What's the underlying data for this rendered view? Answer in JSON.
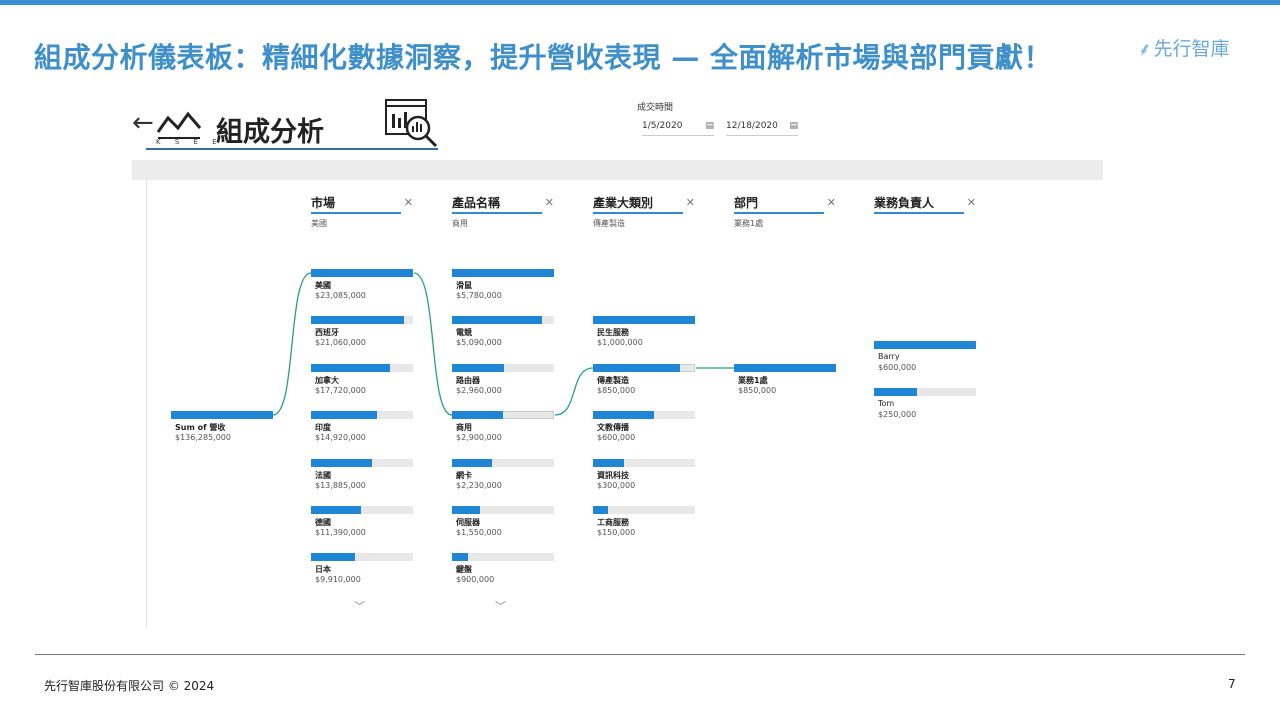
{
  "slide": {
    "title": "組成分析儀表板：精細化數據洞察，提升營收表現 — 全面解析市場與部門貢獻！",
    "brand": "先行智庫",
    "footer": "先行智庫股份有限公司 © 2024",
    "page_number": "7",
    "accent_color": "#3a8fd0"
  },
  "panel": {
    "back_icon": "back-arrow-icon",
    "logo_sub": "K S E E",
    "title": "組成分析",
    "date_filter": {
      "label": "成交時間",
      "start": "1/5/2020",
      "end": "12/18/2020"
    }
  },
  "tree": {
    "root": {
      "label": "Sum of 營收",
      "value": "$136,285,000",
      "fill": 1.0
    },
    "columns": [
      {
        "header": "市場",
        "filter": "美國"
      },
      {
        "header": "產品名稱",
        "filter": "商用"
      },
      {
        "header": "產業大類別",
        "filter": "傳產製造"
      },
      {
        "header": "部門",
        "filter": "業務1處"
      },
      {
        "header": "業務負責人",
        "filter": ""
      }
    ],
    "market": [
      {
        "label": "美國",
        "value": "$23,085,000",
        "fill": 1.0
      },
      {
        "label": "西班牙",
        "value": "$21,060,000",
        "fill": 0.91
      },
      {
        "label": "加拿大",
        "value": "$17,720,000",
        "fill": 0.77
      },
      {
        "label": "印度",
        "value": "$14,920,000",
        "fill": 0.65
      },
      {
        "label": "法國",
        "value": "$13,885,000",
        "fill": 0.6
      },
      {
        "label": "德國",
        "value": "$11,390,000",
        "fill": 0.49
      },
      {
        "label": "日本",
        "value": "$9,910,000",
        "fill": 0.43
      }
    ],
    "product": [
      {
        "label": "滑鼠",
        "value": "$5,780,000",
        "fill": 1.0
      },
      {
        "label": "電競",
        "value": "$5,090,000",
        "fill": 0.88
      },
      {
        "label": "路由器",
        "value": "$2,960,000",
        "fill": 0.51
      },
      {
        "label": "商用",
        "value": "$2,900,000",
        "fill": 0.5
      },
      {
        "label": "網卡",
        "value": "$2,230,000",
        "fill": 0.39
      },
      {
        "label": "伺服器",
        "value": "$1,550,000",
        "fill": 0.27
      },
      {
        "label": "鍵盤",
        "value": "$900,000",
        "fill": 0.16
      }
    ],
    "industry": [
      {
        "label": "民生服務",
        "value": "$1,000,000",
        "fill": 1.0
      },
      {
        "label": "傳產製造",
        "value": "$850,000",
        "fill": 0.85
      },
      {
        "label": "文教傳播",
        "value": "$600,000",
        "fill": 0.6
      },
      {
        "label": "資訊科技",
        "value": "$300,000",
        "fill": 0.3
      },
      {
        "label": "工商服務",
        "value": "$150,000",
        "fill": 0.15
      }
    ],
    "department": [
      {
        "label": "業務1處",
        "value": "$850,000",
        "fill": 1.0
      }
    ],
    "owner": [
      {
        "label": "Barry",
        "value": "$600,000",
        "fill": 1.0
      },
      {
        "label": "Tom",
        "value": "$250,000",
        "fill": 0.42
      }
    ]
  }
}
